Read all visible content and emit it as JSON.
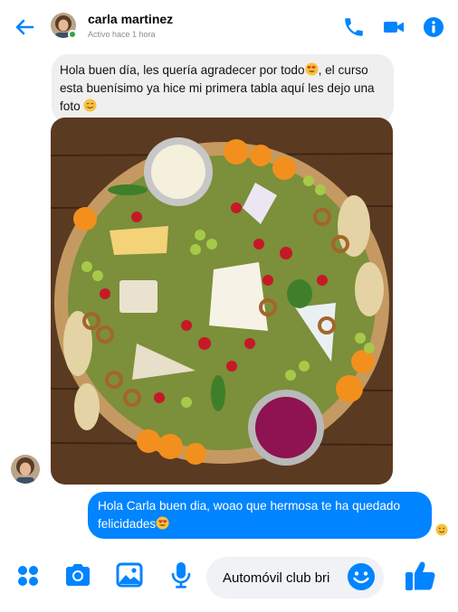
{
  "header": {
    "name": "carla martinez",
    "status": "Activo hace 1 hora"
  },
  "messages": {
    "incoming_text": "Hola buen día, les quería agradecer por todo",
    "incoming_text_2": ", el curso esta buenísimo ya hice mi primera tabla aquí les dejo una foto",
    "outgoing_text": "Hola Carla buen dia, woao que hermosa te ha quedado felicidades"
  },
  "composer": {
    "value": "Automóvil club bri"
  },
  "colors": {
    "accent": "#0084ff",
    "incoming_bubble": "#efefef",
    "online": "#31a24c"
  },
  "icons": [
    "back-arrow-icon",
    "phone-icon",
    "video-camera-icon",
    "info-icon",
    "apps-grid-icon",
    "camera-icon",
    "gallery-icon",
    "microphone-icon",
    "emoji-icon",
    "thumbs-up-icon"
  ]
}
